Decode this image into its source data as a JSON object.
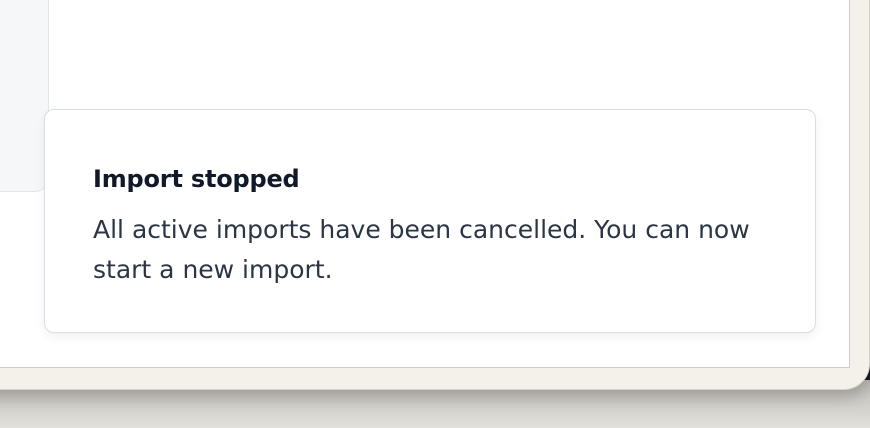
{
  "toast": {
    "title": "Import stopped",
    "message": "All active imports have been cancelled. You can now start a new import."
  },
  "colors": {
    "toast_background": "#ffffff",
    "toast_border": "#d9dee6",
    "title_text": "#111827",
    "body_text": "#2b3545",
    "window_frame": "#f3f1ea"
  }
}
